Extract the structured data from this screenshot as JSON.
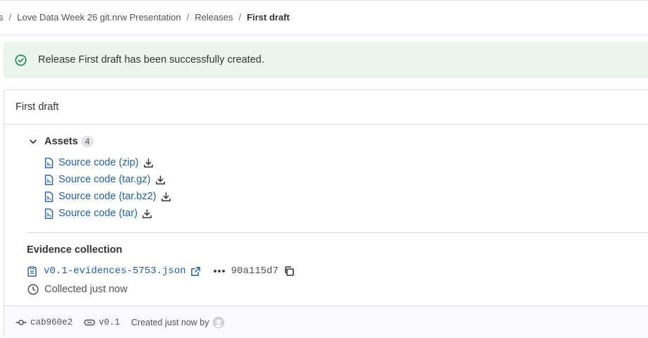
{
  "breadcrumb": {
    "items": [
      "s",
      "Love Data Week 26 git.nrw Presentation",
      "Releases",
      "First draft"
    ]
  },
  "alert": {
    "message": "Release First draft has been successfully created.",
    "icon": "check-circle-icon",
    "color": "#ecf4ee"
  },
  "release": {
    "title": "First draft",
    "assets": {
      "label": "Assets",
      "count": "4",
      "items": [
        {
          "label": "Source code (zip)"
        },
        {
          "label": "Source code (tar.gz)"
        },
        {
          "label": "Source code (tar.bz2)"
        },
        {
          "label": "Source code (tar)"
        }
      ]
    },
    "evidence": {
      "title": "Evidence collection",
      "file": "v0.1-evidences-5753.json",
      "sha": "90a115d7",
      "collected": "Collected just now"
    },
    "footer": {
      "commit": "cab960e2",
      "tag": "v0.1",
      "created": "Created just now by"
    }
  },
  "colors": {
    "link": "#1f5ea8",
    "success": "#108548"
  }
}
